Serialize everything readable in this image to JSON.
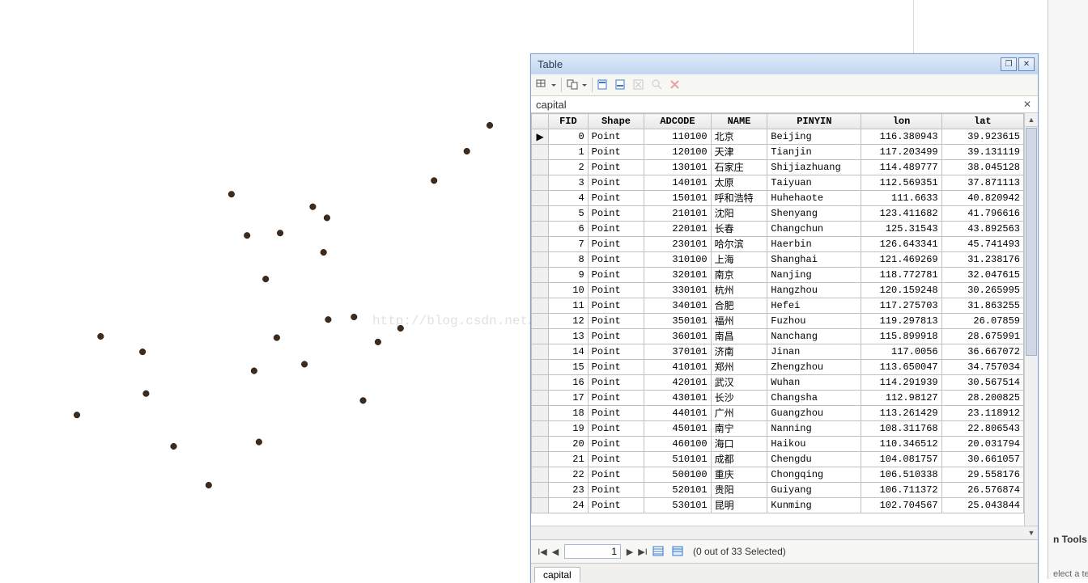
{
  "window": {
    "title": "Table",
    "subheader": "capital",
    "tab_label": "capital"
  },
  "navbar": {
    "current_record": "1",
    "status": "(0 out of 33 Selected)"
  },
  "watermark": "http://blog.csdn.net/JXiSheng",
  "right_panel": {
    "tools": "n Tools",
    "select": "elect a ter"
  },
  "columns": [
    "FID",
    "Shape",
    "ADCODE",
    "NAME",
    "PINYIN",
    "lon",
    "lat"
  ],
  "rows": [
    {
      "fid": "0",
      "shape": "Point",
      "adcode": "110100",
      "name": "北京",
      "pinyin": "Beijing",
      "lon": "116.380943",
      "lat": "39.923615"
    },
    {
      "fid": "1",
      "shape": "Point",
      "adcode": "120100",
      "name": "天津",
      "pinyin": "Tianjin",
      "lon": "117.203499",
      "lat": "39.131119"
    },
    {
      "fid": "2",
      "shape": "Point",
      "adcode": "130101",
      "name": "石家庄",
      "pinyin": "Shijiazhuang",
      "lon": "114.489777",
      "lat": "38.045128"
    },
    {
      "fid": "3",
      "shape": "Point",
      "adcode": "140101",
      "name": "太原",
      "pinyin": "Taiyuan",
      "lon": "112.569351",
      "lat": "37.871113"
    },
    {
      "fid": "4",
      "shape": "Point",
      "adcode": "150101",
      "name": "呼和浩特",
      "pinyin": "Huhehaote",
      "lon": "111.6633",
      "lat": "40.820942"
    },
    {
      "fid": "5",
      "shape": "Point",
      "adcode": "210101",
      "name": "沈阳",
      "pinyin": "Shenyang",
      "lon": "123.411682",
      "lat": "41.796616"
    },
    {
      "fid": "6",
      "shape": "Point",
      "adcode": "220101",
      "name": "长春",
      "pinyin": "Changchun",
      "lon": "125.31543",
      "lat": "43.892563"
    },
    {
      "fid": "7",
      "shape": "Point",
      "adcode": "230101",
      "name": "哈尔滨",
      "pinyin": "Haerbin",
      "lon": "126.643341",
      "lat": "45.741493"
    },
    {
      "fid": "8",
      "shape": "Point",
      "adcode": "310100",
      "name": "上海",
      "pinyin": "Shanghai",
      "lon": "121.469269",
      "lat": "31.238176"
    },
    {
      "fid": "9",
      "shape": "Point",
      "adcode": "320101",
      "name": "南京",
      "pinyin": "Nanjing",
      "lon": "118.772781",
      "lat": "32.047615"
    },
    {
      "fid": "10",
      "shape": "Point",
      "adcode": "330101",
      "name": "杭州",
      "pinyin": "Hangzhou",
      "lon": "120.159248",
      "lat": "30.265995"
    },
    {
      "fid": "11",
      "shape": "Point",
      "adcode": "340101",
      "name": "合肥",
      "pinyin": "Hefei",
      "lon": "117.275703",
      "lat": "31.863255"
    },
    {
      "fid": "12",
      "shape": "Point",
      "adcode": "350101",
      "name": "福州",
      "pinyin": "Fuzhou",
      "lon": "119.297813",
      "lat": "26.07859"
    },
    {
      "fid": "13",
      "shape": "Point",
      "adcode": "360101",
      "name": "南昌",
      "pinyin": "Nanchang",
      "lon": "115.899918",
      "lat": "28.675991"
    },
    {
      "fid": "14",
      "shape": "Point",
      "adcode": "370101",
      "name": "济南",
      "pinyin": "Jinan",
      "lon": "117.0056",
      "lat": "36.667072"
    },
    {
      "fid": "15",
      "shape": "Point",
      "adcode": "410101",
      "name": "郑州",
      "pinyin": "Zhengzhou",
      "lon": "113.650047",
      "lat": "34.757034"
    },
    {
      "fid": "16",
      "shape": "Point",
      "adcode": "420101",
      "name": "武汉",
      "pinyin": "Wuhan",
      "lon": "114.291939",
      "lat": "30.567514"
    },
    {
      "fid": "17",
      "shape": "Point",
      "adcode": "430101",
      "name": "长沙",
      "pinyin": "Changsha",
      "lon": "112.98127",
      "lat": "28.200825"
    },
    {
      "fid": "18",
      "shape": "Point",
      "adcode": "440101",
      "name": "广州",
      "pinyin": "Guangzhou",
      "lon": "113.261429",
      "lat": "23.118912"
    },
    {
      "fid": "19",
      "shape": "Point",
      "adcode": "450101",
      "name": "南宁",
      "pinyin": "Nanning",
      "lon": "108.311768",
      "lat": "22.806543"
    },
    {
      "fid": "20",
      "shape": "Point",
      "adcode": "460100",
      "name": "海口",
      "pinyin": "Haikou",
      "lon": "110.346512",
      "lat": "20.031794"
    },
    {
      "fid": "21",
      "shape": "Point",
      "adcode": "510101",
      "name": "成都",
      "pinyin": "Chengdu",
      "lon": "104.081757",
      "lat": "30.661057"
    },
    {
      "fid": "22",
      "shape": "Point",
      "adcode": "500100",
      "name": "重庆",
      "pinyin": "Chongqing",
      "lon": "106.510338",
      "lat": "29.558176"
    },
    {
      "fid": "23",
      "shape": "Point",
      "adcode": "520101",
      "name": "贵阳",
      "pinyin": "Guiyang",
      "lon": "106.711372",
      "lat": "26.576874"
    },
    {
      "fid": "24",
      "shape": "Point",
      "adcode": "530101",
      "name": "昆明",
      "pinyin": "Kunming",
      "lon": "102.704567",
      "lat": "25.043844"
    }
  ]
}
